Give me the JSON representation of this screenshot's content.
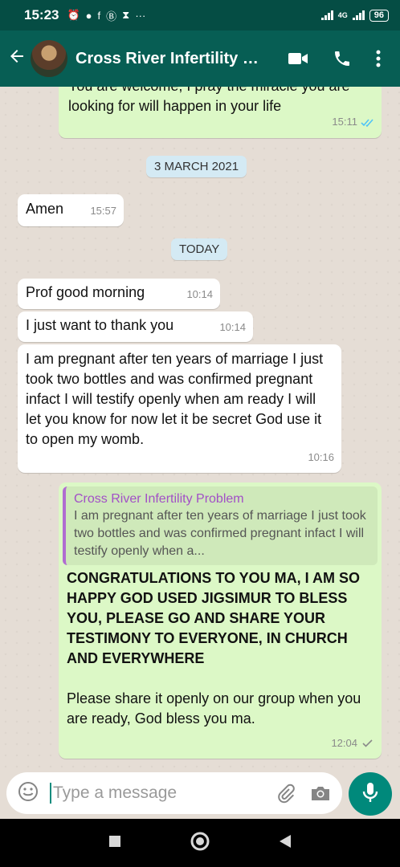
{
  "status_bar": {
    "time": "15:23",
    "network": "4G",
    "battery": "96"
  },
  "header": {
    "title": "Cross River Infertility Problem"
  },
  "messages": {
    "m1": {
      "text": "You are welcome, I pray the miracle you are looking for will happen in your life",
      "time": "15:11"
    },
    "date1": "3 MARCH 2021",
    "m2": {
      "text": "Amen",
      "time": "15:57"
    },
    "date2": "TODAY",
    "m3": {
      "text": "Prof good morning",
      "time": "10:14"
    },
    "m4": {
      "text": "I just want to thank you",
      "time": "10:14"
    },
    "m5": {
      "text": "I am pregnant after ten years of marriage I just took two bottles and was confirmed pregnant infact I will testify openly when am ready I will let you know for now let it be secret God use it to open my womb.",
      "time": "10:16"
    },
    "m6": {
      "quote_name": "Cross River Infertility Problem",
      "quote_text": "I am pregnant after ten years of marriage I just took two bottles and was confirmed pregnant infact I will testify openly when a...",
      "text_bold": "CONGRATULATIONS TO YOU MA, I AM SO HAPPY GOD USED JIGSIMUR TO BLESS YOU, PLEASE GO AND SHARE YOUR TESTIMONY TO EVERYONE, IN CHURCH AND EVERYWHERE",
      "text": "Please share it openly on our group when you are ready, God bless you ma.",
      "time": "12:04"
    }
  },
  "input": {
    "placeholder": "Type a message"
  },
  "colors": {
    "header": "#075e54",
    "status_bar": "#054d44",
    "outgoing_bubble": "#dcf8c6",
    "incoming_bubble": "#ffffff",
    "read_ticks": "#4fc3f7",
    "accent": "#00897b"
  },
  "icons": [
    "back-arrow-icon",
    "video-call-icon",
    "phone-icon",
    "more-vert-icon",
    "emoji-icon",
    "attach-icon",
    "camera-icon",
    "mic-icon",
    "double-check-icon"
  ]
}
